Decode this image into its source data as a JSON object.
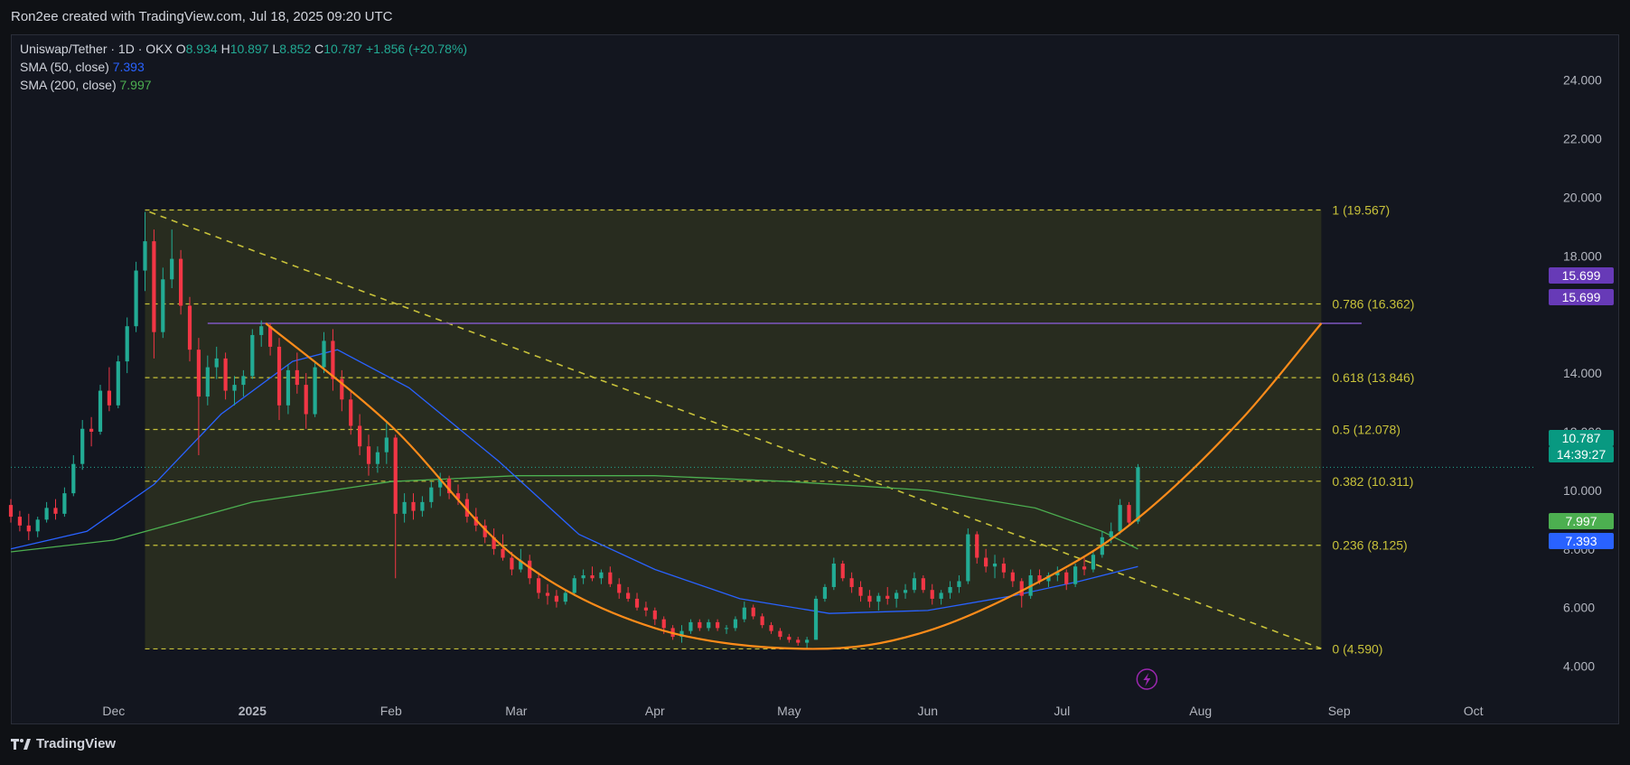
{
  "credit": "Ron2ee created with TradingView.com, Jul 18, 2025 09:20 UTC",
  "footer": {
    "brand": "TradingView"
  },
  "legend": {
    "symbol": "Uniswap/Tether · 1D · OKX",
    "o_label": "O",
    "o": "8.934",
    "h_label": "H",
    "h": "10.897",
    "l_label": "L",
    "l": "8.852",
    "c_label": "C",
    "c": "10.787",
    "change": "+1.856 (+20.78%)",
    "sma50_label": "SMA (50, close)",
    "sma50": "7.393",
    "sma200_label": "SMA (200, close)",
    "sma200": "7.997"
  },
  "badges": {
    "resistance_top": "15.699",
    "resistance_bottom": "15.699",
    "last_price": "10.787",
    "countdown": "14:39:27",
    "sma200": "7.997",
    "sma50": "7.393"
  },
  "colors": {
    "up": "#22ab94",
    "down": "#f23645",
    "sma50": "#2962ff",
    "sma200": "#4caf50",
    "fib": "#c8c23a",
    "cup": "#ff8c1a",
    "resistance": "#7e57c2"
  },
  "chart_data": {
    "type": "candlestick",
    "title": "Uniswap/Tether · 1D · OKX",
    "x_ticks": [
      "Dec",
      "2025",
      "Feb",
      "Mar",
      "Apr",
      "May",
      "Jun",
      "Jul",
      "Aug",
      "Sep",
      "Oct"
    ],
    "y_ticks": [
      "4.000",
      "6.000",
      "8.000",
      "10.000",
      "12.000",
      "14.000",
      "18.000",
      "20.000",
      "22.000",
      "24.000"
    ],
    "y_range": [
      3.0,
      25.5
    ],
    "x_range": [
      "2024-11-08",
      "2025-10-15"
    ],
    "fib_retracement": {
      "from": {
        "date": "2024-12-08",
        "price": 19.567
      },
      "to": {
        "date": "2025-08-28",
        "price": 4.59
      },
      "levels": [
        {
          "ratio": "1",
          "price": 19.567,
          "label": "1 (19.567)"
        },
        {
          "ratio": "0.786",
          "price": 16.362,
          "label": "0.786 (16.362)"
        },
        {
          "ratio": "0.618",
          "price": 13.846,
          "label": "0.618 (13.846)"
        },
        {
          "ratio": "0.5",
          "price": 12.078,
          "label": "0.5 (12.078)"
        },
        {
          "ratio": "0.382",
          "price": 10.311,
          "label": "0.382 (10.311)"
        },
        {
          "ratio": "0.236",
          "price": 8.125,
          "label": "0.236 (8.125)"
        },
        {
          "ratio": "0",
          "price": 4.59,
          "label": "0 (4.590)"
        }
      ]
    },
    "resistance_line": {
      "price": 15.699,
      "from": "2024-12-22",
      "to": "2025-09-06"
    },
    "trendline": [
      {
        "date": "2024-12-09",
        "price": 19.5
      },
      {
        "date": "2025-08-28",
        "price": 4.6
      }
    ],
    "cup_curve": [
      {
        "date": "2025-01-04",
        "price": 15.699
      },
      {
        "date": "2025-02-01",
        "price": 12.2
      },
      {
        "date": "2025-03-01",
        "price": 7.7
      },
      {
        "date": "2025-04-01",
        "price": 5.3
      },
      {
        "date": "2025-05-05",
        "price": 4.59
      },
      {
        "date": "2025-06-01",
        "price": 5.2
      },
      {
        "date": "2025-07-01",
        "price": 7.3
      },
      {
        "date": "2025-07-20",
        "price": 9.3
      },
      {
        "date": "2025-08-10",
        "price": 12.4
      },
      {
        "date": "2025-08-28",
        "price": 15.699
      }
    ],
    "sma50": [
      {
        "date": "2024-11-08",
        "price": 8.0
      },
      {
        "date": "2024-11-25",
        "price": 8.6
      },
      {
        "date": "2024-12-10",
        "price": 10.2
      },
      {
        "date": "2024-12-25",
        "price": 12.6
      },
      {
        "date": "2025-01-10",
        "price": 14.4
      },
      {
        "date": "2025-01-20",
        "price": 14.8
      },
      {
        "date": "2025-02-05",
        "price": 13.5
      },
      {
        "date": "2025-02-25",
        "price": 11.0
      },
      {
        "date": "2025-03-15",
        "price": 8.5
      },
      {
        "date": "2025-04-01",
        "price": 7.3
      },
      {
        "date": "2025-04-20",
        "price": 6.3
      },
      {
        "date": "2025-05-10",
        "price": 5.8
      },
      {
        "date": "2025-06-01",
        "price": 5.9
      },
      {
        "date": "2025-06-20",
        "price": 6.4
      },
      {
        "date": "2025-07-05",
        "price": 6.9
      },
      {
        "date": "2025-07-18",
        "price": 7.4
      }
    ],
    "sma200": [
      {
        "date": "2024-11-08",
        "price": 7.9
      },
      {
        "date": "2024-12-01",
        "price": 8.3
      },
      {
        "date": "2025-01-01",
        "price": 9.6
      },
      {
        "date": "2025-02-01",
        "price": 10.3
      },
      {
        "date": "2025-03-01",
        "price": 10.5
      },
      {
        "date": "2025-04-01",
        "price": 10.5
      },
      {
        "date": "2025-05-01",
        "price": 10.3
      },
      {
        "date": "2025-06-01",
        "price": 10.0
      },
      {
        "date": "2025-06-25",
        "price": 9.4
      },
      {
        "date": "2025-07-10",
        "price": 8.6
      },
      {
        "date": "2025-07-18",
        "price": 8.0
      }
    ],
    "candles": [
      [
        "2024-11-08",
        9.5,
        9.7,
        8.9,
        9.1
      ],
      [
        "2024-11-10",
        9.1,
        9.3,
        8.6,
        8.8
      ],
      [
        "2024-11-12",
        8.8,
        9.2,
        8.3,
        8.6
      ],
      [
        "2024-11-14",
        8.6,
        9.1,
        8.4,
        9.0
      ],
      [
        "2024-11-16",
        9.0,
        9.6,
        8.9,
        9.4
      ],
      [
        "2024-11-18",
        9.4,
        9.7,
        9.0,
        9.2
      ],
      [
        "2024-11-20",
        9.2,
        10.1,
        9.1,
        9.9
      ],
      [
        "2024-11-22",
        9.9,
        11.2,
        9.8,
        10.9
      ],
      [
        "2024-11-24",
        10.9,
        12.4,
        10.7,
        12.1
      ],
      [
        "2024-11-26",
        12.1,
        12.5,
        11.5,
        12.0
      ],
      [
        "2024-11-28",
        12.0,
        13.6,
        11.9,
        13.4
      ],
      [
        "2024-11-30",
        13.4,
        14.2,
        12.7,
        12.9
      ],
      [
        "2024-12-02",
        12.9,
        14.6,
        12.8,
        14.4
      ],
      [
        "2024-12-04",
        14.4,
        15.9,
        14.0,
        15.6
      ],
      [
        "2024-12-06",
        15.6,
        17.8,
        15.4,
        17.5
      ],
      [
        "2024-12-08",
        17.5,
        19.5,
        16.8,
        18.5
      ],
      [
        "2024-12-10",
        18.5,
        18.9,
        14.5,
        15.4
      ],
      [
        "2024-12-12",
        15.4,
        17.6,
        15.2,
        17.2
      ],
      [
        "2024-12-14",
        17.2,
        18.9,
        16.9,
        17.9
      ],
      [
        "2024-12-16",
        17.9,
        18.2,
        16.0,
        16.3
      ],
      [
        "2024-12-18",
        16.3,
        16.6,
        14.4,
        14.8
      ],
      [
        "2024-12-20",
        14.8,
        15.2,
        11.2,
        13.2
      ],
      [
        "2024-12-22",
        13.2,
        14.6,
        12.9,
        14.2
      ],
      [
        "2024-12-24",
        14.2,
        14.9,
        13.8,
        14.5
      ],
      [
        "2024-12-26",
        14.5,
        14.7,
        13.1,
        13.4
      ],
      [
        "2024-12-28",
        13.4,
        13.9,
        12.9,
        13.6
      ],
      [
        "2024-12-30",
        13.6,
        14.1,
        13.2,
        13.9
      ],
      [
        "2025-01-01",
        13.9,
        15.5,
        13.8,
        15.3
      ],
      [
        "2025-01-03",
        15.3,
        15.8,
        14.9,
        15.6
      ],
      [
        "2025-01-05",
        15.6,
        15.7,
        14.6,
        14.9
      ],
      [
        "2025-01-07",
        14.9,
        15.2,
        12.4,
        12.9
      ],
      [
        "2025-01-09",
        12.9,
        14.3,
        12.6,
        14.1
      ],
      [
        "2025-01-11",
        14.1,
        14.7,
        13.3,
        13.6
      ],
      [
        "2025-01-13",
        13.6,
        14.0,
        12.1,
        12.6
      ],
      [
        "2025-01-15",
        12.6,
        14.4,
        12.5,
        14.2
      ],
      [
        "2025-01-17",
        14.2,
        15.4,
        14.0,
        15.1
      ],
      [
        "2025-01-19",
        15.1,
        15.5,
        13.4,
        13.8
      ],
      [
        "2025-01-21",
        13.8,
        14.1,
        12.7,
        13.1
      ],
      [
        "2025-01-23",
        13.1,
        13.4,
        11.9,
        12.2
      ],
      [
        "2025-01-25",
        12.2,
        12.6,
        11.2,
        11.5
      ],
      [
        "2025-01-27",
        11.5,
        11.9,
        10.5,
        10.9
      ],
      [
        "2025-01-29",
        10.9,
        11.5,
        10.6,
        11.3
      ],
      [
        "2025-01-31",
        11.3,
        12.3,
        10.9,
        11.8
      ],
      [
        "2025-02-02",
        11.8,
        11.9,
        7.0,
        9.2
      ],
      [
        "2025-02-04",
        9.2,
        9.9,
        8.9,
        9.6
      ],
      [
        "2025-02-06",
        9.6,
        9.9,
        9.0,
        9.3
      ],
      [
        "2025-02-08",
        9.3,
        9.8,
        9.1,
        9.6
      ],
      [
        "2025-02-10",
        9.6,
        10.3,
        9.4,
        10.1
      ],
      [
        "2025-02-12",
        10.1,
        10.6,
        9.8,
        10.4
      ],
      [
        "2025-02-14",
        10.4,
        10.5,
        9.7,
        9.9
      ],
      [
        "2025-02-16",
        9.9,
        10.2,
        9.5,
        9.7
      ],
      [
        "2025-02-18",
        9.7,
        9.9,
        8.9,
        9.1
      ],
      [
        "2025-02-20",
        9.1,
        9.4,
        8.6,
        8.8
      ],
      [
        "2025-02-22",
        8.8,
        9.0,
        8.2,
        8.4
      ],
      [
        "2025-02-24",
        8.4,
        8.7,
        7.8,
        8.0
      ],
      [
        "2025-02-26",
        8.0,
        8.5,
        7.6,
        7.7
      ],
      [
        "2025-02-28",
        7.7,
        7.9,
        7.1,
        7.3
      ],
      [
        "2025-03-02",
        7.3,
        8.0,
        7.2,
        7.6
      ],
      [
        "2025-03-04",
        7.6,
        7.8,
        6.8,
        7.0
      ],
      [
        "2025-03-06",
        7.0,
        7.2,
        6.3,
        6.5
      ],
      [
        "2025-03-08",
        6.5,
        6.8,
        6.1,
        6.4
      ],
      [
        "2025-03-10",
        6.4,
        6.6,
        6.0,
        6.2
      ],
      [
        "2025-03-12",
        6.2,
        6.6,
        6.1,
        6.5
      ],
      [
        "2025-03-14",
        6.5,
        7.1,
        6.4,
        7.0
      ],
      [
        "2025-03-16",
        7.0,
        7.3,
        6.8,
        7.1
      ],
      [
        "2025-03-18",
        7.1,
        7.4,
        6.9,
        7.0
      ],
      [
        "2025-03-20",
        7.0,
        7.3,
        6.8,
        7.2
      ],
      [
        "2025-03-22",
        7.2,
        7.4,
        6.7,
        6.8
      ],
      [
        "2025-03-24",
        6.8,
        7.0,
        6.3,
        6.5
      ],
      [
        "2025-03-26",
        6.5,
        6.7,
        6.2,
        6.3
      ],
      [
        "2025-03-28",
        6.3,
        6.5,
        5.9,
        6.0
      ],
      [
        "2025-03-30",
        6.0,
        6.2,
        5.7,
        5.9
      ],
      [
        "2025-04-01",
        5.9,
        6.0,
        5.4,
        5.6
      ],
      [
        "2025-04-03",
        5.6,
        5.7,
        5.1,
        5.3
      ],
      [
        "2025-04-05",
        5.3,
        5.4,
        4.9,
        5.0
      ],
      [
        "2025-04-07",
        5.0,
        5.4,
        4.8,
        5.2
      ],
      [
        "2025-04-09",
        5.2,
        5.6,
        5.1,
        5.5
      ],
      [
        "2025-04-11",
        5.5,
        5.6,
        5.2,
        5.3
      ],
      [
        "2025-04-13",
        5.3,
        5.6,
        5.2,
        5.5
      ],
      [
        "2025-04-15",
        5.5,
        5.6,
        5.2,
        5.3
      ],
      [
        "2025-04-17",
        5.3,
        5.4,
        5.1,
        5.3
      ],
      [
        "2025-04-19",
        5.3,
        5.7,
        5.2,
        5.6
      ],
      [
        "2025-04-21",
        5.6,
        6.2,
        5.5,
        6.0
      ],
      [
        "2025-04-23",
        6.0,
        6.1,
        5.6,
        5.7
      ],
      [
        "2025-04-25",
        5.7,
        5.8,
        5.3,
        5.4
      ],
      [
        "2025-04-27",
        5.4,
        5.5,
        5.1,
        5.2
      ],
      [
        "2025-04-29",
        5.2,
        5.3,
        4.9,
        5.0
      ],
      [
        "2025-05-01",
        5.0,
        5.1,
        4.8,
        4.9
      ],
      [
        "2025-05-03",
        4.9,
        5.0,
        4.7,
        4.8
      ],
      [
        "2025-05-05",
        4.8,
        5.0,
        4.6,
        4.9
      ],
      [
        "2025-05-07",
        4.9,
        6.4,
        4.9,
        6.3
      ],
      [
        "2025-05-09",
        6.3,
        6.8,
        6.2,
        6.7
      ],
      [
        "2025-05-11",
        6.7,
        7.7,
        6.6,
        7.5
      ],
      [
        "2025-05-13",
        7.5,
        7.6,
        6.9,
        7.0
      ],
      [
        "2025-05-15",
        7.0,
        7.2,
        6.5,
        6.7
      ],
      [
        "2025-05-17",
        6.7,
        6.9,
        6.2,
        6.4
      ],
      [
        "2025-05-19",
        6.4,
        6.6,
        6.0,
        6.2
      ],
      [
        "2025-05-21",
        6.2,
        6.5,
        5.9,
        6.4
      ],
      [
        "2025-05-23",
        6.4,
        6.7,
        6.1,
        6.3
      ],
      [
        "2025-05-25",
        6.3,
        6.6,
        6.0,
        6.5
      ],
      [
        "2025-05-27",
        6.5,
        6.8,
        6.3,
        6.6
      ],
      [
        "2025-05-29",
        6.6,
        7.2,
        6.5,
        7.0
      ],
      [
        "2025-05-31",
        7.0,
        7.1,
        6.5,
        6.6
      ],
      [
        "2025-06-02",
        6.6,
        6.8,
        6.1,
        6.3
      ],
      [
        "2025-06-04",
        6.3,
        6.6,
        6.1,
        6.5
      ],
      [
        "2025-06-06",
        6.5,
        6.9,
        6.3,
        6.7
      ],
      [
        "2025-06-08",
        6.7,
        7.1,
        6.5,
        6.9
      ],
      [
        "2025-06-10",
        6.9,
        8.7,
        6.8,
        8.5
      ],
      [
        "2025-06-12",
        8.5,
        8.6,
        7.5,
        7.7
      ],
      [
        "2025-06-14",
        7.7,
        8.0,
        7.2,
        7.4
      ],
      [
        "2025-06-16",
        7.4,
        7.8,
        7.0,
        7.5
      ],
      [
        "2025-06-18",
        7.5,
        7.7,
        7.0,
        7.2
      ],
      [
        "2025-06-20",
        7.2,
        7.3,
        6.7,
        6.9
      ],
      [
        "2025-06-22",
        6.9,
        7.0,
        6.0,
        6.4
      ],
      [
        "2025-06-24",
        6.4,
        7.3,
        6.3,
        7.1
      ],
      [
        "2025-06-26",
        7.1,
        7.3,
        6.8,
        6.9
      ],
      [
        "2025-06-28",
        6.9,
        7.2,
        6.7,
        7.1
      ],
      [
        "2025-06-30",
        7.1,
        7.4,
        6.9,
        7.2
      ],
      [
        "2025-07-02",
        7.2,
        7.3,
        6.6,
        6.8
      ],
      [
        "2025-07-04",
        6.8,
        7.5,
        6.7,
        7.4
      ],
      [
        "2025-07-06",
        7.4,
        7.7,
        7.1,
        7.3
      ],
      [
        "2025-07-08",
        7.3,
        7.9,
        7.2,
        7.8
      ],
      [
        "2025-07-10",
        7.8,
        8.6,
        7.7,
        8.4
      ],
      [
        "2025-07-12",
        8.4,
        8.9,
        8.2,
        8.6
      ],
      [
        "2025-07-14",
        8.6,
        9.7,
        8.5,
        9.5
      ],
      [
        "2025-07-16",
        9.5,
        9.6,
        8.8,
        8.9
      ],
      [
        "2025-07-18",
        8.934,
        10.897,
        8.852,
        10.787
      ]
    ]
  }
}
